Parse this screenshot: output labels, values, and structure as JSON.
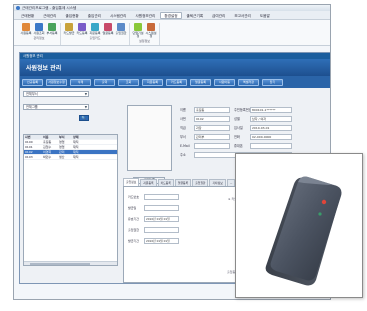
{
  "window": {
    "title": "근태관리프로그램 - 출입통제 시스템"
  },
  "menus": [
    "근태현황",
    "근태관리",
    "출입현황",
    "출입관리",
    "시스템관리",
    "사원정보관리",
    "환경설정",
    "출퇴근기록",
    "급여관리",
    "보고서관리",
    "도움말"
  ],
  "active_menu_index": 6,
  "ribbon": {
    "groups": [
      {
        "title": "관리정보",
        "buttons": [
          "사원등록",
          "사원조회",
          "부서등록"
        ]
      },
      {
        "title": "출입카드",
        "buttons": [
          "카드발급",
          "카드등록",
          "지문등록",
          "얼굴등록",
          "출입권한"
        ]
      },
      {
        "title": "설정정보",
        "buttons": [
          "단말기설정",
          "시스템설정"
        ]
      }
    ]
  },
  "subwindow": {
    "title": "사원정보 관리",
    "header": "사원정보 관리"
  },
  "toolbar_buttons": [
    "신규등록",
    "사원정보수정",
    "삭제",
    "출력",
    "조회",
    "지문등록",
    "카드등록",
    "얼굴등록",
    "사원이동",
    "엑셀저장",
    "닫기"
  ],
  "filters": {
    "dept": "전체부서",
    "group": "전체그룹",
    "search_button": "🔍"
  },
  "list": {
    "columns": [
      "사번",
      "이름",
      "부서",
      "상태"
    ],
    "rows": [
      [
        "0100",
        "홍길동",
        "영업",
        "재직"
      ],
      [
        "0101",
        "김철수",
        "영업",
        "재직"
      ],
      [
        "0102",
        "이영희",
        "관리",
        "재직"
      ],
      [
        "0103",
        "박민수",
        "생산",
        "재직"
      ]
    ],
    "selected_index": 2
  },
  "photo_button": "사진등록",
  "form": {
    "rows": [
      [
        "이름",
        "홍길동",
        "주민등록번호",
        "800101-1******"
      ],
      [
        "사번",
        "0102",
        "성별",
        "남자 / 여자"
      ],
      [
        "직급",
        "과장",
        "입사일",
        "2010-03-01"
      ],
      [
        "부서",
        "관리부",
        "전화",
        "02-000-0000"
      ],
      [
        "E-Mail",
        "",
        "휴대폰",
        ""
      ],
      [
        "주소",
        "",
        "",
        ""
      ]
    ],
    "note": "관리권한"
  },
  "tabs": {
    "labels": [
      "출입정보",
      "지문등록",
      "카드등록",
      "얼굴등록",
      "출입권한",
      "기타정보",
      "..."
    ],
    "active_index": 0,
    "fields": [
      [
        "카드번호",
        ""
      ],
      [
        "발급일",
        ""
      ],
      [
        "유효기간",
        "2010년 01월 01일"
      ],
      [
        "출입권한",
        ""
      ],
      [
        "발급기간",
        "2010년 01월 01일"
      ]
    ],
    "panel_note": "※ 카드 / 지문 정보",
    "bottom_label": "출입등록"
  },
  "popup": {
    "device": "card-reader-device"
  },
  "colors": {
    "header": "#1d4f8f",
    "button": "#2e6bb4",
    "accent": "#3a78c8"
  }
}
